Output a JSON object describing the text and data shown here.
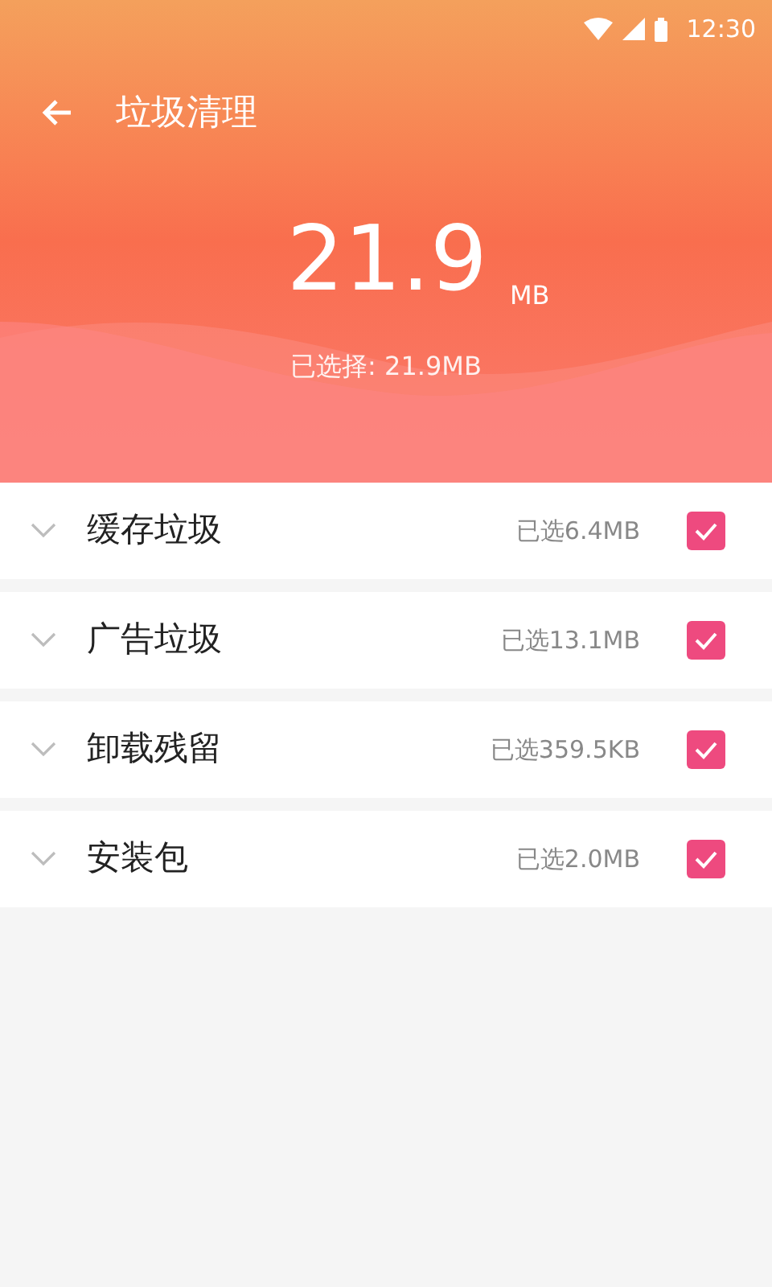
{
  "status_bar": {
    "time": "12:30"
  },
  "header": {
    "title": "垃圾清理",
    "total": "21.9",
    "unit": "MB",
    "selected_summary": "已选择: 21.9MB"
  },
  "items": [
    {
      "label": "缓存垃圾",
      "size": "已选6.4MB",
      "checked": true,
      "expanded": false
    },
    {
      "label": "广告垃圾",
      "size": "已选13.1MB",
      "checked": true,
      "expanded": false
    },
    {
      "label": "卸载残留",
      "size": "已选359.5KB",
      "checked": true,
      "expanded": false
    },
    {
      "label": "安装包",
      "size": "已选2.0MB",
      "checked": true,
      "expanded": false
    }
  ]
}
